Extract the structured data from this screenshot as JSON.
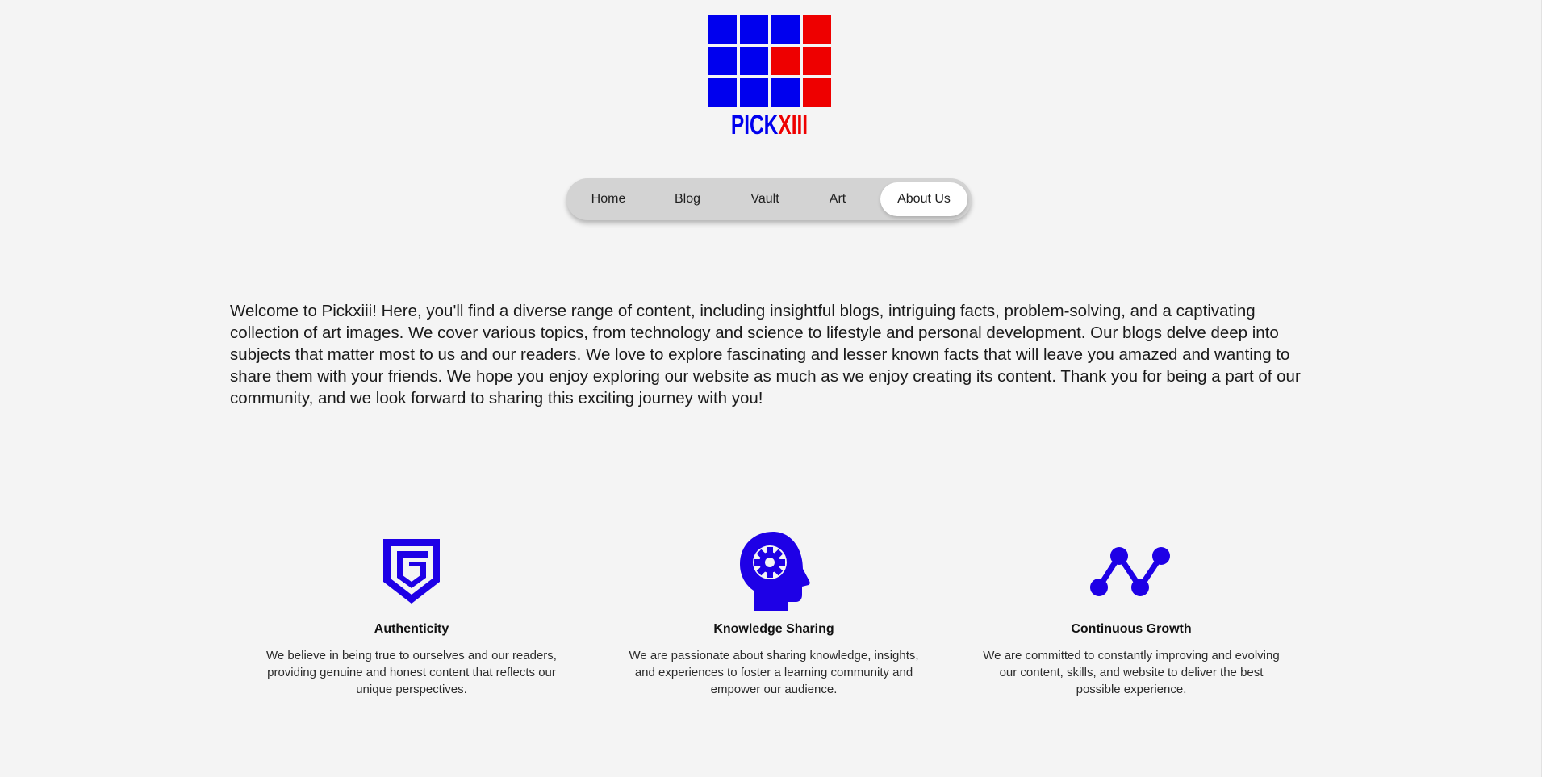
{
  "brand": {
    "word_part1": "PICK",
    "word_part2": "XIII",
    "colors": {
      "blue": "#0000ee",
      "red": "#ee0000",
      "accent": "#1e00e6"
    },
    "grid": [
      [
        "blue",
        "blue",
        "blue",
        "red"
      ],
      [
        "blue",
        "blue",
        "red",
        "red"
      ],
      [
        "blue",
        "blue",
        "blue",
        "red"
      ]
    ]
  },
  "nav": {
    "items": [
      {
        "label": "Home",
        "active": false
      },
      {
        "label": "Blog",
        "active": false
      },
      {
        "label": "Vault",
        "active": false
      },
      {
        "label": "Art",
        "active": false
      },
      {
        "label": "About Us",
        "active": true
      }
    ]
  },
  "intro": {
    "text": "Welcome to Pickxiii! Here, you'll find a diverse range of content, including insightful blogs, intriguing facts, problem-solving, and a captivating collection of art images. We cover various topics, from technology and science to lifestyle and personal development. Our blogs delve deep into subjects that matter most to us and our readers. We love to explore fascinating and lesser known facts that will leave you amazed and wanting to share them with your friends. We hope you enjoy exploring our website as much as we enjoy creating its content. Thank you for being a part of our community, and we look forward to sharing this exciting journey with you!"
  },
  "features": [
    {
      "icon": "shield-badge-icon",
      "title": "Authenticity",
      "description": "We believe in being true to ourselves and our readers, providing genuine and honest content that reflects our unique perspectives."
    },
    {
      "icon": "head-gear-icon",
      "title": "Knowledge Sharing",
      "description": "We are passionate about sharing knowledge, insights, and experiences to foster a learning community and empower our audience."
    },
    {
      "icon": "growth-graph-icon",
      "title": "Continuous Growth",
      "description": "We are committed to constantly improving and evolving our content, skills, and website to deliver the best possible experience."
    }
  ]
}
